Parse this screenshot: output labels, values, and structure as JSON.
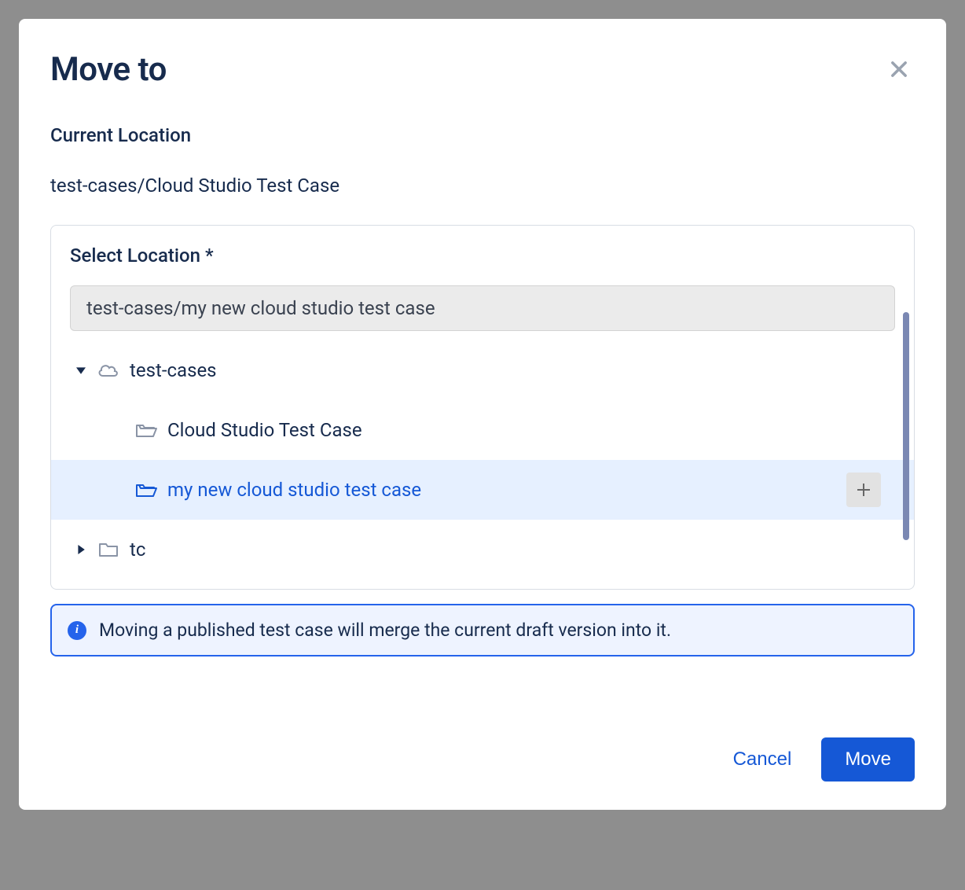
{
  "modal": {
    "title": "Move to",
    "current_location_label": "Current Location",
    "current_location_value": "test-cases/Cloud Studio Test Case",
    "select_location_label": "Select Location *",
    "path_input_value": "test-cases/my new cloud studio test case",
    "info_message": "Moving a published test case will merge the current draft version into it.",
    "cancel_label": "Cancel",
    "move_label": "Move"
  },
  "tree": {
    "root": {
      "label": "test-cases",
      "expanded": true,
      "icon": "cloud"
    },
    "children": [
      {
        "label": "Cloud Studio Test Case",
        "icon": "folder-open-gray",
        "selected": false
      },
      {
        "label": "my new cloud studio test case",
        "icon": "folder-open-blue",
        "selected": true,
        "has_add": true
      },
      {
        "label": "tc",
        "icon": "folder-closed",
        "expandable": true,
        "expanded": false
      }
    ]
  }
}
